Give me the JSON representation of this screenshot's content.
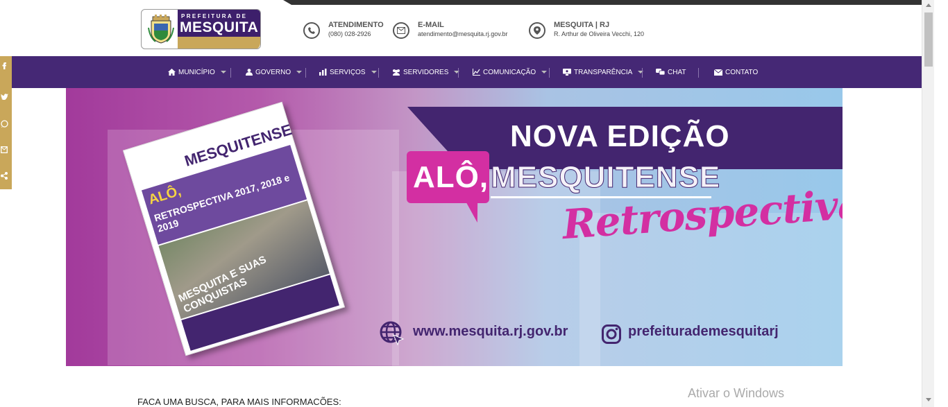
{
  "header": {
    "logo": {
      "line1": "PREFEITURA DE",
      "line2": "MESQUITA"
    },
    "contacts": [
      {
        "icon": "phone-icon",
        "title": "ATENDIMENTO",
        "sub": "(080) 028-2926"
      },
      {
        "icon": "mail-icon",
        "title": "E-MAIL",
        "sub": "atendimento@mesquita.rj.gov.br"
      },
      {
        "icon": "map-pin-icon",
        "title": "MESQUITA | RJ",
        "sub": "R. Arthur de Oliveira Vecchi, 120"
      }
    ]
  },
  "nav": {
    "items": [
      {
        "label": "MUNICÍPIO",
        "icon": "home-icon",
        "dropdown": true
      },
      {
        "label": "GOVERNO",
        "icon": "user-icon",
        "dropdown": true
      },
      {
        "label": "SERVIÇOS",
        "icon": "bar-chart-icon",
        "dropdown": true
      },
      {
        "label": "SERVIDORES",
        "icon": "group-icon",
        "dropdown": true
      },
      {
        "label": "COMUNICAÇÃO",
        "icon": "line-chart-icon",
        "dropdown": true
      },
      {
        "label": "TRANSPARÊNCIA",
        "icon": "monitor-icon",
        "dropdown": true
      },
      {
        "label": "CHAT",
        "icon": "chat-icon",
        "dropdown": false
      },
      {
        "label": "CONTATO",
        "icon": "envelope-icon",
        "dropdown": false
      }
    ]
  },
  "social": [
    "facebook-icon",
    "twitter-icon",
    "whatsapp-icon",
    "email-share-icon",
    "share-icon"
  ],
  "banner": {
    "headline": "NOVA EDIÇÃO",
    "alo": "ALÔ,",
    "mesquitense": "MESQUITENSE",
    "retrospectiva": "Retrospectiva",
    "website": "www.mesquita.rj.gov.br",
    "instagram": "prefeiturademesquitarj",
    "magazine": {
      "title": "MESQUITENSE",
      "alo": "ALÔ,",
      "retro": "RETROSPECTIVA 2017, 2018 e 2019",
      "conquistas": "MESQUITA E SUAS CONQUISTAS"
    }
  },
  "search_title": "FACA UMA BUSCA, PARA MAIS INFORMACÕES:",
  "watermark": "Ativar o Windows"
}
